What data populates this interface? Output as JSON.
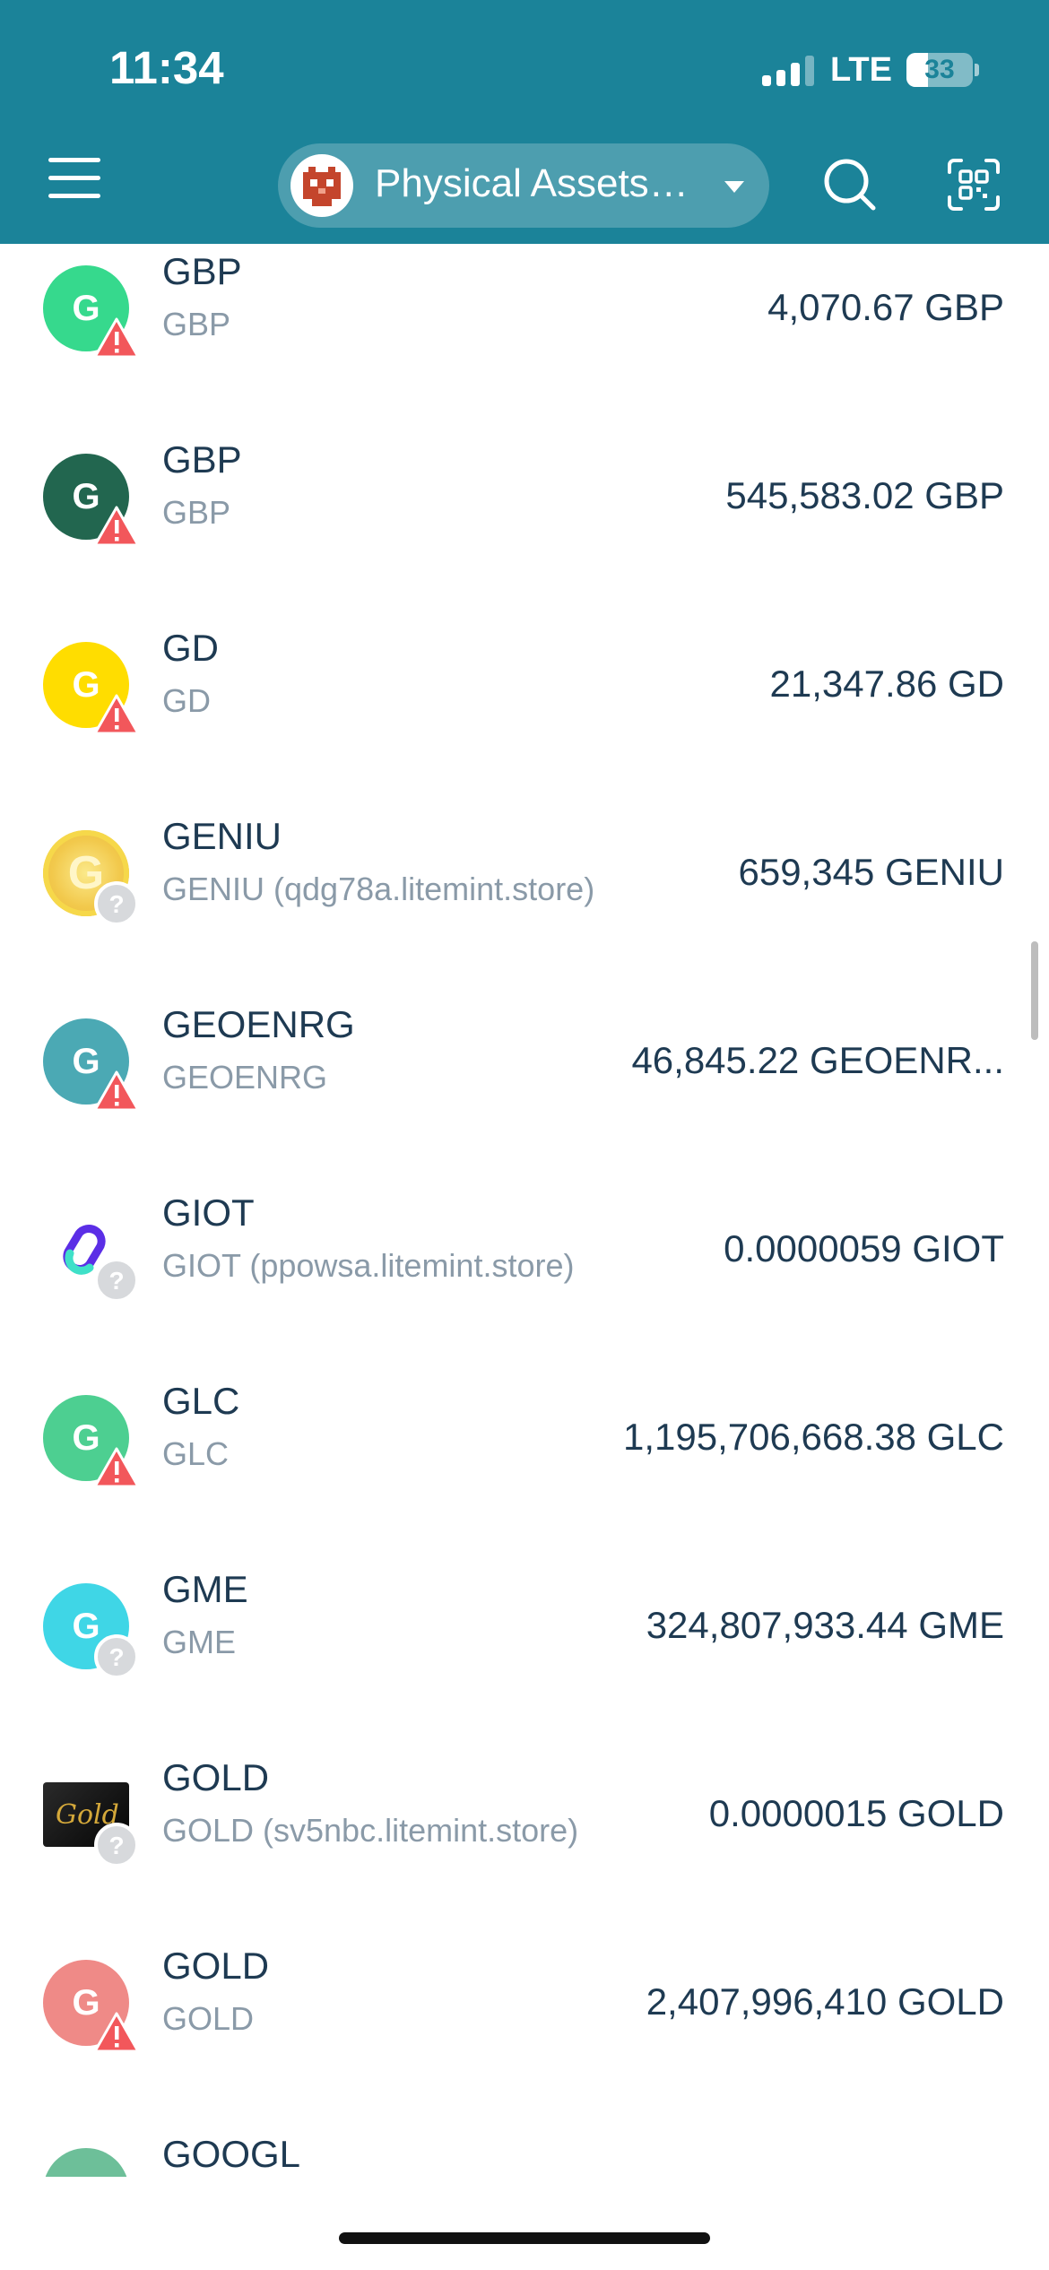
{
  "status_bar": {
    "time": "11:34",
    "network": "LTE",
    "battery": "33",
    "battery_level": 0.33
  },
  "header": {
    "account_name": "Physical Assets Multisig Wallet",
    "icons": {
      "menu": "hamburger-menu-icon",
      "search": "search-icon",
      "scan": "qr-scan-icon",
      "caret": "caret-down-icon"
    },
    "colors": {
      "bar": "#1b8399"
    }
  },
  "assets": [
    {
      "name": "GBP",
      "subtitle": "GBP",
      "balance": "4,070.67 GBP",
      "icon_letter": "G",
      "icon_color": "#36d98d",
      "badge": "warning"
    },
    {
      "name": "GBP",
      "subtitle": "GBP",
      "balance": "545,583.02 GBP",
      "icon_letter": "G",
      "icon_color": "#22664f",
      "badge": "warning"
    },
    {
      "name": "GD",
      "subtitle": "GD",
      "balance": "21,347.86 GD",
      "icon_letter": "G",
      "icon_color": "#ffdd00",
      "badge": "warning"
    },
    {
      "name": "GENIU",
      "subtitle": "GENIU (qdg78a.litemint.store)",
      "balance": "659,345 GENIU",
      "icon_letter": "G",
      "icon_color": "#f6d84a",
      "badge": "unknown"
    },
    {
      "name": "GEOENRG",
      "subtitle": "GEOENRG",
      "balance": "46,845.22 GEOENR...",
      "icon_letter": "G",
      "icon_color": "#4ba9b4",
      "badge": "warning"
    },
    {
      "name": "GIOT",
      "subtitle": "GIOT (ppowsa.litemint.store)",
      "balance": "0.0000059 GIOT",
      "icon_letter": "",
      "icon_color": "#ffffff",
      "badge": "unknown"
    },
    {
      "name": "GLC",
      "subtitle": "GLC",
      "balance": "1,195,706,668.38 GLC",
      "icon_letter": "G",
      "icon_color": "#4dcf91",
      "badge": "warning"
    },
    {
      "name": "GME",
      "subtitle": "GME",
      "balance": "324,807,933.44 GME",
      "icon_letter": "G",
      "icon_color": "#3fd6e6",
      "badge": "unknown"
    },
    {
      "name": "GOLD",
      "subtitle": "GOLD (sv5nbc.litemint.store)",
      "balance": "0.0000015 GOLD",
      "icon_letter": "",
      "icon_color": "#111111",
      "badge": "unknown"
    },
    {
      "name": "GOLD",
      "subtitle": "GOLD",
      "balance": "2,407,996,410 GOLD",
      "icon_letter": "G",
      "icon_color": "#ef8a87",
      "badge": "warning"
    },
    {
      "name": "GOOGL",
      "subtitle": "",
      "balance": "",
      "icon_letter": "",
      "icon_color": "#6dbf99",
      "badge": ""
    }
  ]
}
